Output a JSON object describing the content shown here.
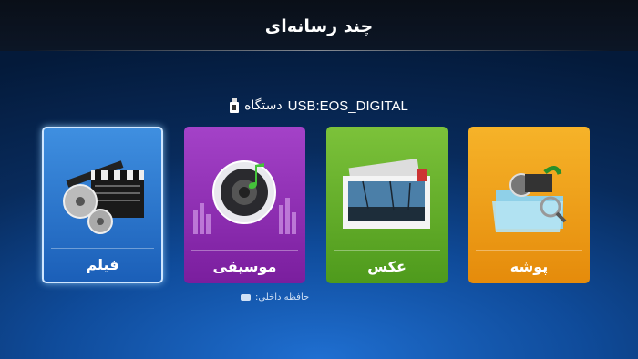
{
  "header": {
    "title": "چند رسانه‌ای"
  },
  "device": {
    "name": "USB:EOS_DIGITAL",
    "label": "دستگاه",
    "icon": "usb-icon"
  },
  "tiles": [
    {
      "label": "فیلم",
      "icon": "film-clapper-icon",
      "color": "#2f7fd6",
      "selected": true
    },
    {
      "label": "موسیقی",
      "icon": "music-speaker-icon",
      "color": "#9333b8"
    },
    {
      "label": "عکس",
      "icon": "photo-frame-icon",
      "color": "#66b42c"
    },
    {
      "label": "پوشه",
      "icon": "folder-icon",
      "color": "#f0a21b"
    }
  ],
  "internal_storage": {
    "label": "حافظه داخلی:",
    "icon": "hdd-icon"
  }
}
